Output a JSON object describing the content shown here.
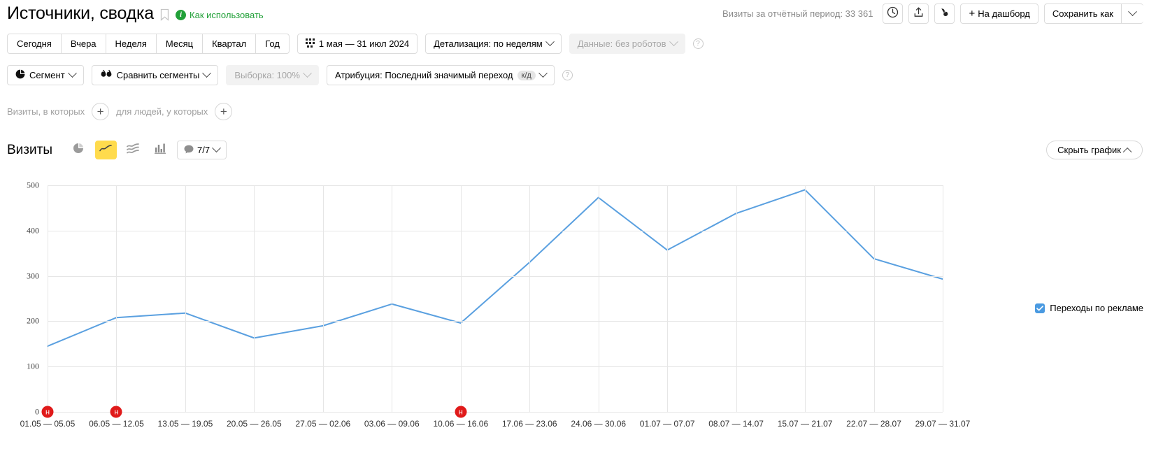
{
  "header": {
    "title": "Источники, сводка",
    "bookmark_icon": "bookmark-icon",
    "howto_label": "Как использовать",
    "howto_icon": "info-icon",
    "visits_summary": "Визиты за отчётный период: 33 361",
    "history_icon": "clock-history-icon",
    "export_icon": "share-export-icon",
    "compare_icon": "compare-icon",
    "dashboard_button": "На дашборд",
    "save_as_button": "Сохранить как",
    "save_as_caret_icon": "chevron-down-icon"
  },
  "toolbar": {
    "periods": [
      "Сегодня",
      "Вчера",
      "Неделя",
      "Месяц",
      "Квартал",
      "Год"
    ],
    "date_range": "1 мая — 31 июл 2024",
    "calendar_icon": "calendar-grid-icon",
    "detalization": "Детализация: по неделям",
    "data_robots": "Данные: без роботов",
    "data_robots_disabled": true,
    "help_icon": "question-icon",
    "segment": "Сегмент",
    "segment_icon": "pie-segment-icon",
    "compare_segments": "Сравнить сегменты",
    "compare_segments_icon": "two-drops-icon",
    "sampling": "Выборка: 100%",
    "sampling_disabled": true,
    "attribution": "Атрибуция: Последний значимый переход",
    "attribution_badge": "к/д"
  },
  "filters": {
    "visits_label": "Визиты, в которых",
    "people_label": "для людей, у которых",
    "add_icon": "plus-icon"
  },
  "chart_toolbar": {
    "metric": "Визиты",
    "views": [
      {
        "name": "pie-chart-view",
        "label": "Круговая",
        "active": false
      },
      {
        "name": "line-chart-view",
        "label": "Линейная",
        "active": true
      },
      {
        "name": "area-chart-view",
        "label": "С областями",
        "active": false
      },
      {
        "name": "bar-chart-view",
        "label": "Столбчатая",
        "active": false
      }
    ],
    "comments": "7/7",
    "comment_icon": "speech-bubble-icon",
    "hide_chart": "Скрыть график",
    "hide_chart_icon": "chevron-up-icon"
  },
  "legend": {
    "items": [
      {
        "label": "Переходы по рекламе",
        "color": "#4a9ae1",
        "checked": true
      }
    ]
  },
  "colors": {
    "line": "#5aa0e0",
    "accent": "#ffdb4d",
    "green": "#21a038",
    "grid": "#e6e6e6",
    "holiday": "#e01a1a"
  },
  "chart_data": {
    "type": "line",
    "title": "Визиты",
    "xlabel": "",
    "ylabel": "",
    "ylim": [
      0,
      500
    ],
    "yticks": [
      0,
      100,
      200,
      300,
      400,
      500
    ],
    "grid": true,
    "legend_position": "right",
    "categories": [
      "01.05 — 05.05",
      "06.05 — 12.05",
      "13.05 — 19.05",
      "20.05 — 26.05",
      "27.05 — 02.06",
      "03.06 — 09.06",
      "10.06 — 16.06",
      "17.06 — 23.06",
      "24.06 — 30.06",
      "01.07 — 07.07",
      "08.07 — 14.07",
      "15.07 — 21.07",
      "22.07 — 28.07",
      "29.07 — 31.07"
    ],
    "series": [
      {
        "name": "Переходы по рекламе",
        "color": "#5aa0e0",
        "values": [
          145,
          208,
          218,
          163,
          190,
          238,
          196,
          330,
          473,
          357,
          438,
          490,
          338,
          293
        ]
      }
    ],
    "annotations": [
      {
        "type": "holiday",
        "label": "н",
        "category_index": 0
      },
      {
        "type": "holiday",
        "label": "н",
        "category_index": 1
      },
      {
        "type": "holiday",
        "label": "н",
        "category_index": 6
      }
    ]
  }
}
